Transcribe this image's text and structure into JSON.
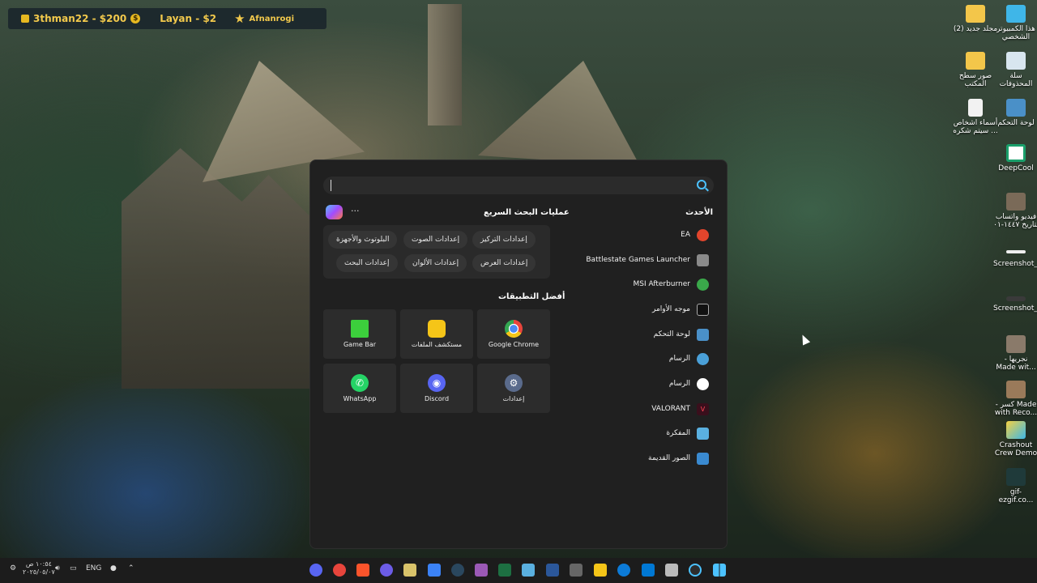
{
  "widget": {
    "user1": "3thman22 - $200",
    "user2": "Layan - $2",
    "user3": "Afnanrogi",
    "user1_icon": "dollar-coin-icon",
    "user3_icon": "star-icon"
  },
  "desktop_icons": [
    {
      "label": "هذا الكمبيوتر الشخصي",
      "icon": "monitor-icon"
    },
    {
      "label": "(2) مجلد جديد",
      "icon": "folder-icon"
    },
    {
      "label": "سلة المحذوفات",
      "icon": "recycle-bin-icon"
    },
    {
      "label": "صور سطح المكتب",
      "icon": "folder-icon"
    },
    {
      "label": "لوحة التحكم",
      "icon": "control-panel-icon"
    },
    {
      "label": "أسماء اشخاص سيتم شكره ...",
      "icon": "document-icon"
    },
    {
      "label": "DeepCool",
      "icon": "deepcool-icon"
    },
    {
      "label": "فيديو واتساب بتاريخ ١٤٤٧-٠١",
      "icon": "video-icon"
    },
    {
      "label": "Screenshot_1",
      "icon": "image-icon"
    },
    {
      "label": "Screenshot_2",
      "icon": "image-icon"
    },
    {
      "label": "- نجريها Made wit...",
      "icon": "video-icon"
    },
    {
      "label": "- كسر Made with Reco...",
      "icon": "video-icon"
    },
    {
      "label": "Crashout Crew Demo",
      "icon": "game-icon"
    },
    {
      "label": "gif-ezgif.co...",
      "icon": "image-icon"
    }
  ],
  "panel": {
    "search_placeholder": "",
    "quick_search_title": "عمليات البحث السريع",
    "more_label": "···",
    "quick_chips": [
      "إعدادات التركيز",
      "إعدادات الصوت",
      "البلوتوث والأجهزة",
      "إعدادات العرض",
      "إعدادات الألوان",
      "إعدادات البحث"
    ],
    "top_apps_title": "أفضل التطبيقات",
    "top_apps": [
      {
        "label": "Google Chrome",
        "icon": "chrome-icon",
        "color": "#e8453c"
      },
      {
        "label": "مستكشف الملفات",
        "icon": "file-explorer-icon",
        "color": "#f5c518"
      },
      {
        "label": "Game Bar",
        "icon": "game-bar-icon",
        "color": "#3ccf3c"
      },
      {
        "label": "إعدادات",
        "icon": "settings-gear-icon",
        "color": "#5a6b8c"
      },
      {
        "label": "Discord",
        "icon": "discord-icon",
        "color": "#5865f2"
      },
      {
        "label": "WhatsApp",
        "icon": "whatsapp-icon",
        "color": "#25d366"
      }
    ],
    "recent_title": "الأحدث",
    "recent": [
      {
        "label": "EA",
        "icon": "ea-icon",
        "color": "#e2452c"
      },
      {
        "label": "Battlestate Games Launcher",
        "icon": "battlestate-icon",
        "color": "#8a8a8a"
      },
      {
        "label": "MSI Afterburner",
        "icon": "msi-afterburner-icon",
        "color": "#3aa84a"
      },
      {
        "label": "موجه الأوامر",
        "icon": "command-prompt-icon",
        "color": "#111111"
      },
      {
        "label": "لوحة التحكم",
        "icon": "control-panel-icon",
        "color": "#4a90c8"
      },
      {
        "label": "الرسام",
        "icon": "paint-icon",
        "color": "#4aa0d8"
      },
      {
        "label": "الرسام",
        "icon": "paint-search-icon",
        "color": "#ffffff"
      },
      {
        "label": "VALORANT",
        "icon": "valorant-icon",
        "color": "#3a0f1c"
      },
      {
        "label": "المفكرة",
        "icon": "notepad-icon",
        "color": "#5ab0e0"
      },
      {
        "label": "الصور القديمة",
        "icon": "photos-icon",
        "color": "#3a8ad0"
      }
    ]
  },
  "taskbar": {
    "time": "١٠:٥٤ ص",
    "date": "٢٠٢٥/٠٥/٠٧",
    "lang": "ENG",
    "apps": [
      {
        "icon": "discord-icon",
        "color": "#5865f2"
      },
      {
        "icon": "chrome-icon",
        "color": "#e8453c"
      },
      {
        "icon": "brave-icon",
        "color": "#fb542b"
      },
      {
        "icon": "arc-icon",
        "color": "#6c5ce7"
      },
      {
        "icon": "notes-icon",
        "color": "#d9c36a"
      },
      {
        "icon": "store-icon",
        "color": "#3b82f6"
      },
      {
        "icon": "steam-icon",
        "color": "#2a475e"
      },
      {
        "icon": "feather-icon",
        "color": "#9b59b6"
      },
      {
        "icon": "excel-icon",
        "color": "#1d6f42"
      },
      {
        "icon": "notepad-icon",
        "color": "#5ab0e0"
      },
      {
        "icon": "word-icon",
        "color": "#2b579a"
      },
      {
        "icon": "calculator-icon",
        "color": "#666666"
      },
      {
        "icon": "file-explorer-icon",
        "color": "#f5c518"
      },
      {
        "icon": "edge-icon",
        "color": "#0c7bd8"
      },
      {
        "icon": "mail-icon",
        "color": "#0078d4"
      },
      {
        "icon": "task-view-icon",
        "color": "#bbbbbb"
      },
      {
        "icon": "search-icon",
        "color": "#4cc2ff"
      },
      {
        "icon": "start-windows-icon",
        "color": "#4cc2ff"
      }
    ]
  }
}
